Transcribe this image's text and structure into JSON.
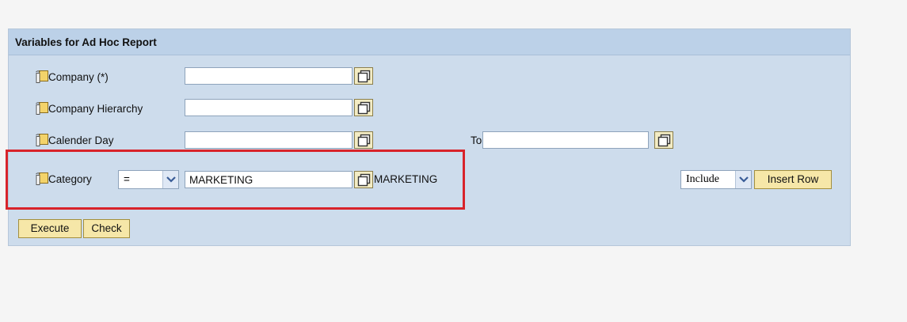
{
  "panel": {
    "title": "Variables for Ad Hoc Report"
  },
  "variables": {
    "company": {
      "label": "Company (*)",
      "value": ""
    },
    "company_hierarchy": {
      "label": "Company Hierarchy",
      "value": ""
    },
    "calendar_day": {
      "label": "Calender Day",
      "value": "",
      "to_label": "To",
      "to_value": ""
    },
    "category": {
      "label": "Category",
      "operator": "=",
      "value": "MARKETING",
      "description": "MARKETING",
      "include_option": "Include",
      "insert_row_label": "Insert Row"
    }
  },
  "actions": {
    "execute_label": "Execute",
    "check_label": "Check"
  },
  "icons": {
    "variable": "variable-selection-icon",
    "value_help": "value-help-icon",
    "dropdown": "chevron-down-icon"
  },
  "colors": {
    "panel_bg": "#cddcec",
    "header_bg": "#bcd1e8",
    "button_bg": "#f6e7a8",
    "highlight": "#d8232a"
  }
}
